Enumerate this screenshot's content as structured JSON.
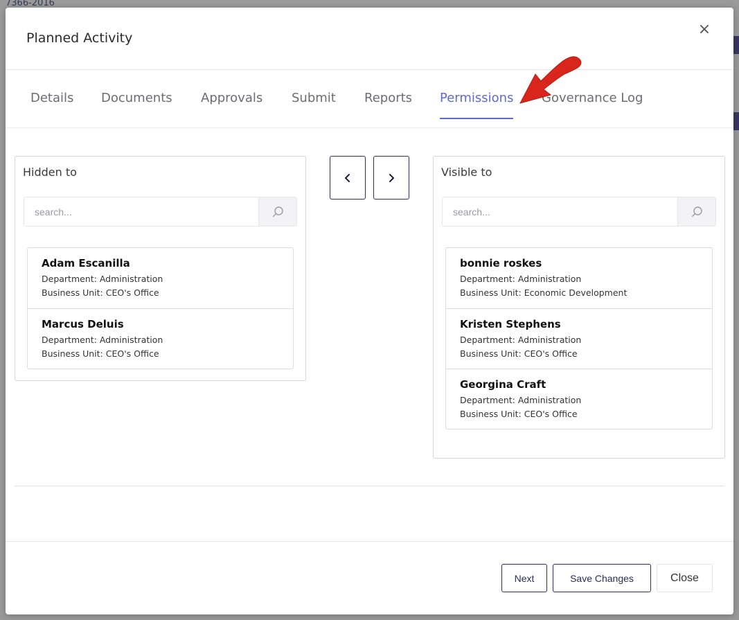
{
  "background": {
    "fragment_text": "7366-2016",
    "accent_strip_color": "#3b3563"
  },
  "modal": {
    "title": "Planned Activity",
    "close_glyph": "×"
  },
  "tabs": [
    {
      "label": "Details",
      "active": false
    },
    {
      "label": "Documents",
      "active": false
    },
    {
      "label": "Approvals",
      "active": false
    },
    {
      "label": "Submit",
      "active": false
    },
    {
      "label": "Reports",
      "active": false
    },
    {
      "label": "Permissions",
      "active": true
    },
    {
      "label": "Governance Log",
      "active": false
    }
  ],
  "hidden_panel": {
    "title": "Hidden to",
    "search_placeholder": "search...",
    "items": [
      {
        "name": "Adam Escanilla",
        "department": "Department: Administration",
        "business_unit": "Business Unit: CEO's Office"
      },
      {
        "name": "Marcus Deluis",
        "department": "Department: Administration",
        "business_unit": "Business Unit: CEO's Office"
      }
    ]
  },
  "visible_panel": {
    "title": "Visible to",
    "search_placeholder": "search...",
    "items": [
      {
        "name": "bonnie roskes",
        "department": "Department: Administration",
        "business_unit": "Business Unit: Economic Development"
      },
      {
        "name": "Kristen Stephens",
        "department": "Department: Administration",
        "business_unit": "Business Unit: CEO's Office"
      },
      {
        "name": "Georgina Craft",
        "department": "Department: Administration",
        "business_unit": "Business Unit: CEO's Office"
      }
    ]
  },
  "transfer": {
    "move_left_icon": "chevron-left-icon",
    "move_right_icon": "chevron-right-icon"
  },
  "footer": {
    "next_label": "Next",
    "save_label": "Save Changes",
    "close_label": "Close"
  },
  "colors": {
    "accent": "#5b6bd6",
    "primary_dark": "#2c2d5a",
    "annotation_arrow": "#d9261c"
  }
}
